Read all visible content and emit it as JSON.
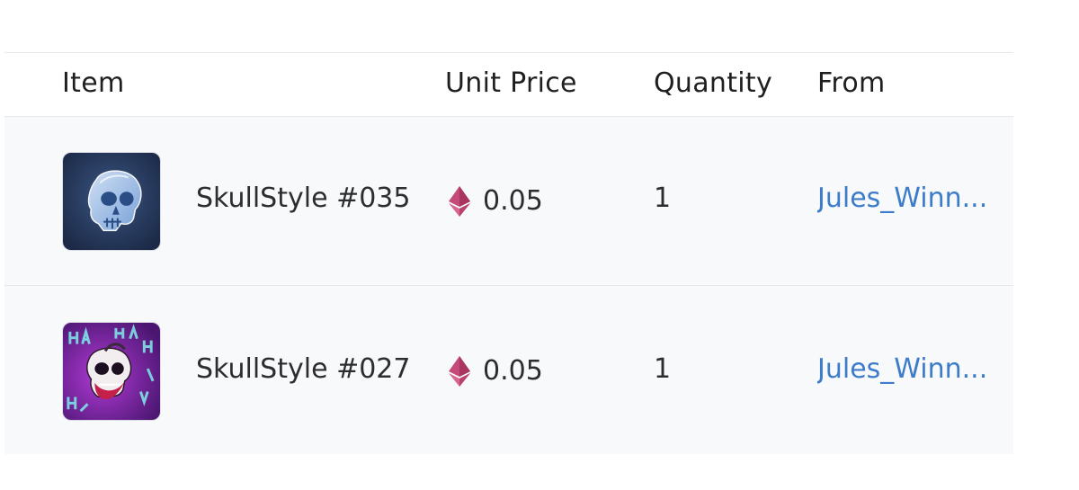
{
  "table": {
    "columns": {
      "item": "Item",
      "unit_price": "Unit Price",
      "quantity": "Quantity",
      "from": "From"
    },
    "rows": [
      {
        "name": "SkullStyle #035",
        "price": "0.05",
        "quantity": "1",
        "from": "Jules_Winn..."
      },
      {
        "name": "SkullStyle #027",
        "price": "0.05",
        "quantity": "1",
        "from": "Jules_Winn..."
      }
    ]
  },
  "colors": {
    "link": "#3d7cc9",
    "eth_icon": "#c44a7a",
    "row_background": "#f8f9fb",
    "divider": "#e4e7ec"
  },
  "icons": {
    "price_currency": "ethereum-icon"
  }
}
